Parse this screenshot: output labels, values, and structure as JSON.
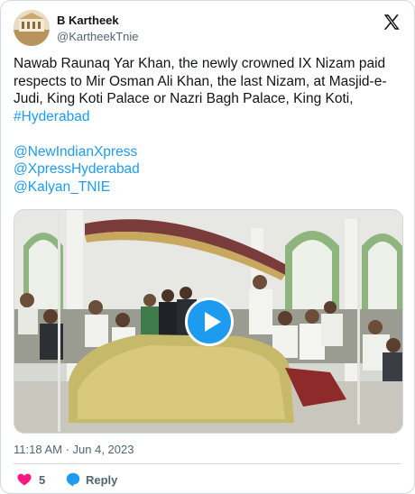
{
  "author": {
    "name": "B Kartheek",
    "handle": "@KartheekTnie",
    "avatar_icon": "profile-photo"
  },
  "tweet": {
    "text": "Nawab Raunaq Yar Khan, the newly crowned IX Nizam paid respects to Mir Osman Ali Khan, the last Nizam, at Masjid-e-Judi, King Koti Palace or Nazri Bagh Palace, King Koti, ",
    "hashtag": "#Hyderabad",
    "mentions": [
      "@NewIndianXpress",
      "@XpressHyderabad",
      "@Kalyan_TNIE"
    ]
  },
  "media": {
    "type": "video",
    "play_icon": "play-button-icon"
  },
  "meta": {
    "timestamp": "11:18 AM · Jun 4, 2023"
  },
  "actions": {
    "like_count": "5",
    "reply_label": "Reply"
  },
  "colors": {
    "accent": "#1d9bf0",
    "heart": "#f91880",
    "text": "#0f1419",
    "secondary": "#536471",
    "border": "#cfd9de"
  }
}
